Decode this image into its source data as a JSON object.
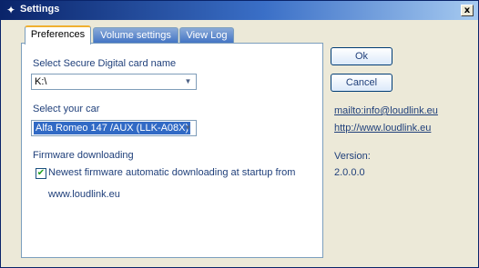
{
  "window": {
    "title": "Settings",
    "close_label": "x"
  },
  "tabs": [
    {
      "label": "Preferences",
      "active": true
    },
    {
      "label": "Volume settings",
      "active": false
    },
    {
      "label": "View Log",
      "active": false
    }
  ],
  "sd_card": {
    "label": "Select Secure Digital card name",
    "value": "K:\\"
  },
  "car": {
    "label": "Select your car",
    "value": "Alfa Romeo 147 /AUX (LLK-A08X)"
  },
  "firmware": {
    "label": "Firmware downloading",
    "checkbox_label": "Newest firmware automatic downloading at startup from",
    "checkbox_label_line2": "www.loudlink.eu",
    "checked": true
  },
  "buttons": {
    "ok": "Ok",
    "cancel": "Cancel"
  },
  "links": {
    "email": "mailto:info@loudlink.eu",
    "website": "http://www.loudlink.eu"
  },
  "version": {
    "label": "Version:",
    "value": "2.0.0.0"
  },
  "icons": {
    "title_icon": "wrench-icon",
    "dropdown": "chevron-down-icon",
    "check": "checkmark-icon"
  },
  "colors": {
    "title_gradient_start": "#0a246a",
    "title_gradient_end": "#a6caf0",
    "label_text": "#1f3f7a",
    "selection": "#316ac5",
    "tab_highlight": "#f0b030"
  }
}
